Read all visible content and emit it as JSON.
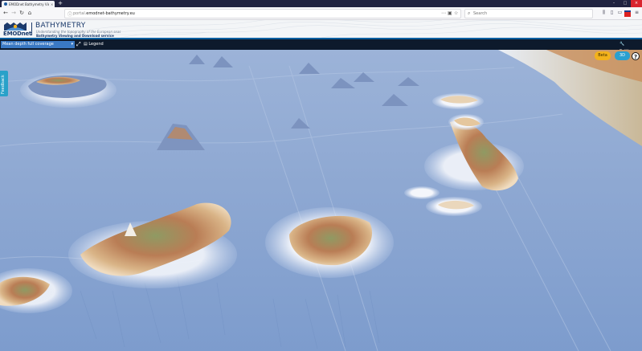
{
  "browser": {
    "tab_title": "EMODnet Bathymetry Viewin...",
    "tab_close": "×",
    "new_tab": "+",
    "url_prefix": "portal.",
    "url_domain": "emodnet-bathymetry.eu",
    "search_placeholder": "Search",
    "win_min": "–",
    "win_max": "□",
    "win_close": "×"
  },
  "site": {
    "logo_text": "EMODnet",
    "title": "BATHYMETRY",
    "tagline": "Understanding the topography of the European seas",
    "subtitle": "Bathymetry Viewing and Download service"
  },
  "toolbar": {
    "layer_selected": "Mean depth full coverage",
    "legend_label": "Legend",
    "settings_label": "Settings"
  },
  "map": {
    "feedback_label": "Feedback",
    "beta_label": "Beta",
    "mode_3d_label": "3D",
    "help_label": "?"
  },
  "icons": {
    "back": "back-icon",
    "forward": "forward-icon",
    "reload": "reload-icon",
    "home": "home-icon",
    "lock": "lock-icon",
    "reader": "reader-view-icon",
    "bookmark": "bookmark-star-icon",
    "search": "search-icon",
    "fullscreen": "fullscreen-icon",
    "legend": "document-icon",
    "settings": "wrench-icon"
  },
  "colors": {
    "brand": "#1b3a6b",
    "toolbar_bg": "#0d1a2c",
    "layer_select": "#3a79c4",
    "feedback": "#29a1c9",
    "beta": "#f3b21c",
    "mode_3d": "#2aa0d0"
  }
}
